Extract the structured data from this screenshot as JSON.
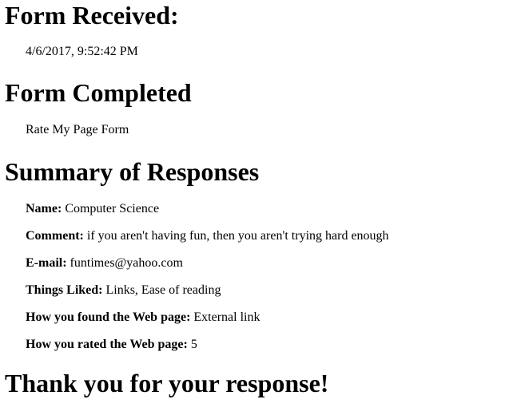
{
  "received": {
    "heading": "Form Received:",
    "timestamp": "4/6/2017, 9:52:42 PM"
  },
  "completed": {
    "heading": "Form Completed",
    "form_name": "Rate My Page Form"
  },
  "summary": {
    "heading": "Summary of Responses",
    "responses": [
      {
        "label": "Name:",
        "value": "Computer Science"
      },
      {
        "label": "Comment:",
        "value": "if you aren't having fun, then you aren't trying hard enough"
      },
      {
        "label": "E-mail:",
        "value": "funtimes@yahoo.com"
      },
      {
        "label": "Things Liked:",
        "value": "Links, Ease of reading"
      },
      {
        "label": "How you found the Web page:",
        "value": "External link"
      },
      {
        "label": "How you rated the Web page:",
        "value": "5"
      }
    ]
  },
  "thanks": {
    "heading": "Thank you for your response!"
  }
}
